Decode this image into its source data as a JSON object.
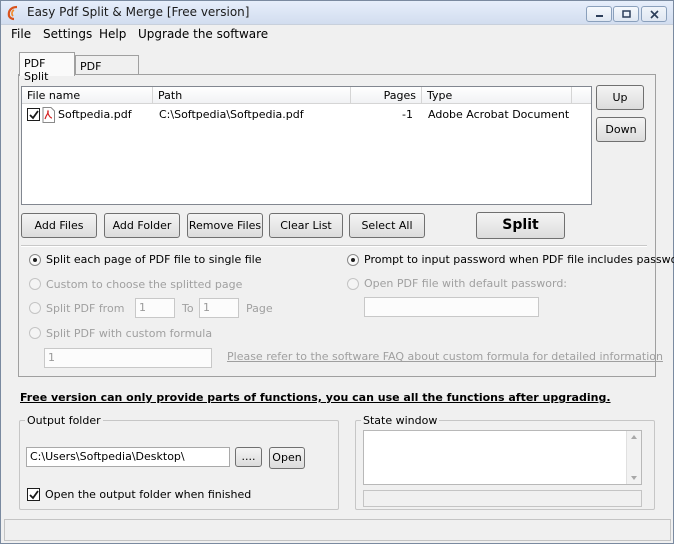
{
  "window": {
    "title": "Easy Pdf Split & Merge [Free version]"
  },
  "menu": {
    "items": [
      "File",
      "Settings",
      "Help",
      "Upgrade the software"
    ]
  },
  "tabs": {
    "split": "PDF Split",
    "merge": "PDF Merge"
  },
  "file_list": {
    "columns": [
      "File name",
      "Path",
      "Pages",
      "Type"
    ],
    "rows": [
      {
        "checked": true,
        "name": "Softpedia.pdf",
        "path": "C:\\Softpedia\\Softpedia.pdf",
        "pages": "-1",
        "type": "Adobe Acrobat Document"
      }
    ]
  },
  "side_buttons": {
    "up": "Up",
    "down": "Down"
  },
  "action_buttons": {
    "add_files": "Add Files",
    "add_folder": "Add Folder",
    "remove_files": "Remove Files",
    "clear_list": "Clear List",
    "select_all": "Select All",
    "split": "Split"
  },
  "options": {
    "split_each_page": "Split each page of PDF file to single file",
    "custom_choose": "Custom to choose the splitted page",
    "split_from": "Split PDF from",
    "from_value": "1",
    "to_label": "To",
    "to_value": "1",
    "page_label": "Page",
    "custom_formula": "Split PDF with custom formula",
    "formula_value": "1",
    "faq_link": "Please refer to the software FAQ about custom formula for detailed information",
    "prompt_password": "Prompt to input password when PDF file includes password",
    "default_password": "Open PDF file with default password:",
    "password_value": ""
  },
  "notice": "Free version can only provide parts of functions, you can use all the functions after upgrading.",
  "output": {
    "group_title": "Output folder",
    "path": "C:\\Users\\Softpedia\\Desktop\\",
    "browse_label": "....",
    "open_label": "Open",
    "open_when_finished": "Open the output folder when finished",
    "open_when_finished_checked": true
  },
  "state": {
    "group_title": "State window",
    "text": ""
  },
  "status_bar": {
    "text": ""
  }
}
